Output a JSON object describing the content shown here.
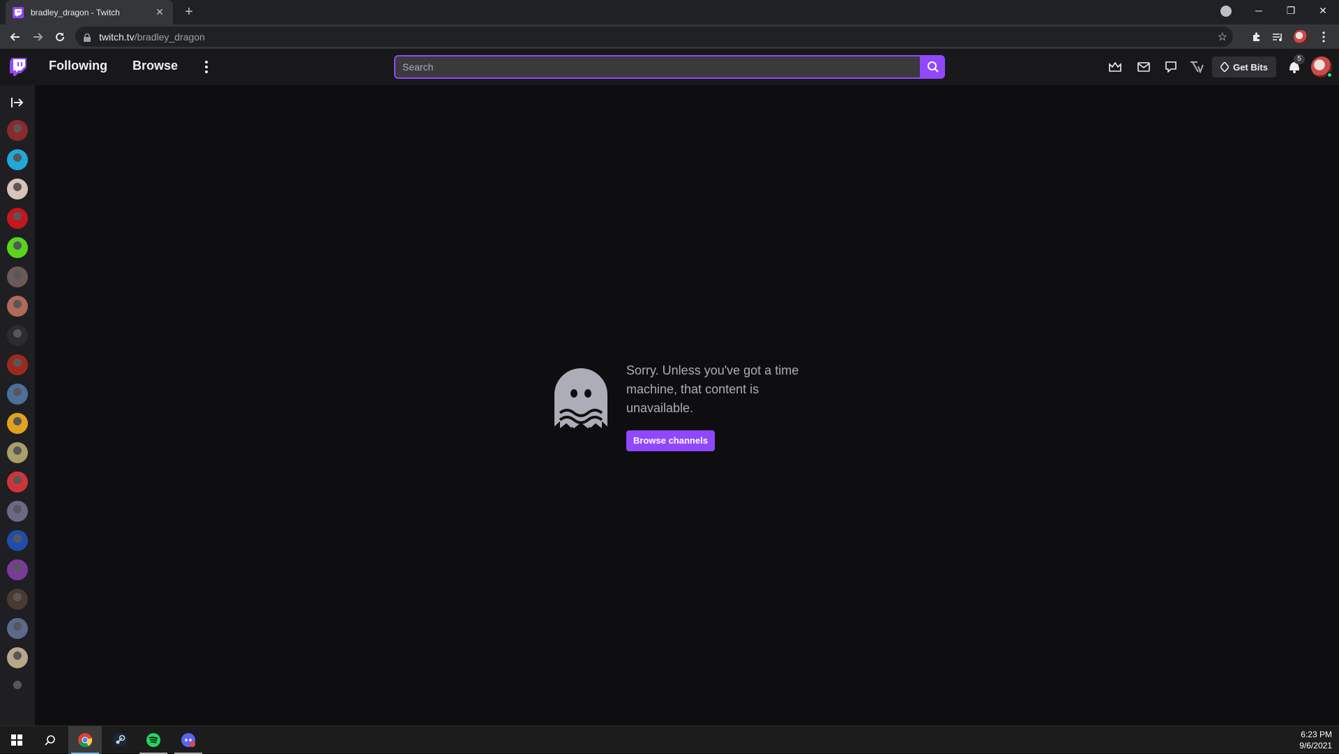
{
  "browser": {
    "tab_title": "bradley_dragon - Twitch",
    "tab_close": "✕",
    "new_tab": "+",
    "url_host": "twitch.tv",
    "url_path": "/bradley_dragon",
    "window_controls": [
      "─",
      "❐",
      "✕"
    ]
  },
  "twitch_nav": {
    "following": "Following",
    "browse": "Browse",
    "search_placeholder": "Search",
    "get_bits": "Get Bits",
    "notification_count": "5"
  },
  "sidebar": {
    "avatars": [
      {
        "name": "channel-1",
        "color": "#8a2a2a"
      },
      {
        "name": "channel-2",
        "color": "#1fa8d8"
      },
      {
        "name": "channel-3",
        "color": "#d9c2b6"
      },
      {
        "name": "channel-4",
        "color": "#c4161c"
      },
      {
        "name": "channel-5",
        "color": "#58d41c"
      },
      {
        "name": "channel-6",
        "color": "#6a5a58"
      },
      {
        "name": "channel-7",
        "color": "#b06a56"
      },
      {
        "name": "channel-8",
        "color": "#2b2b30"
      },
      {
        "name": "channel-9",
        "color": "#9c2a1c"
      },
      {
        "name": "channel-10",
        "color": "#4e6f9a"
      },
      {
        "name": "channel-11",
        "color": "#e2a21c"
      },
      {
        "name": "channel-12",
        "color": "#a8a068"
      },
      {
        "name": "channel-13",
        "color": "#d0343a"
      },
      {
        "name": "channel-14",
        "color": "#6a6a88"
      },
      {
        "name": "channel-15",
        "color": "#1e4ea8"
      },
      {
        "name": "channel-16",
        "color": "#7a3a9a"
      },
      {
        "name": "channel-17",
        "color": "#4a3a30"
      },
      {
        "name": "channel-18",
        "color": "#5a6a8a"
      },
      {
        "name": "channel-19",
        "color": "#b8a888"
      },
      {
        "name": "channel-20",
        "color": "#1f1f23"
      }
    ]
  },
  "error": {
    "message": "Sorry. Unless you've got a time machine, that content is unavailable.",
    "button": "Browse channels"
  },
  "taskbar": {
    "time": "6:23 PM",
    "date": "9/6/2021"
  },
  "colors": {
    "accent": "#9147ff",
    "background": "#0e0e10",
    "nav": "#18181b"
  }
}
